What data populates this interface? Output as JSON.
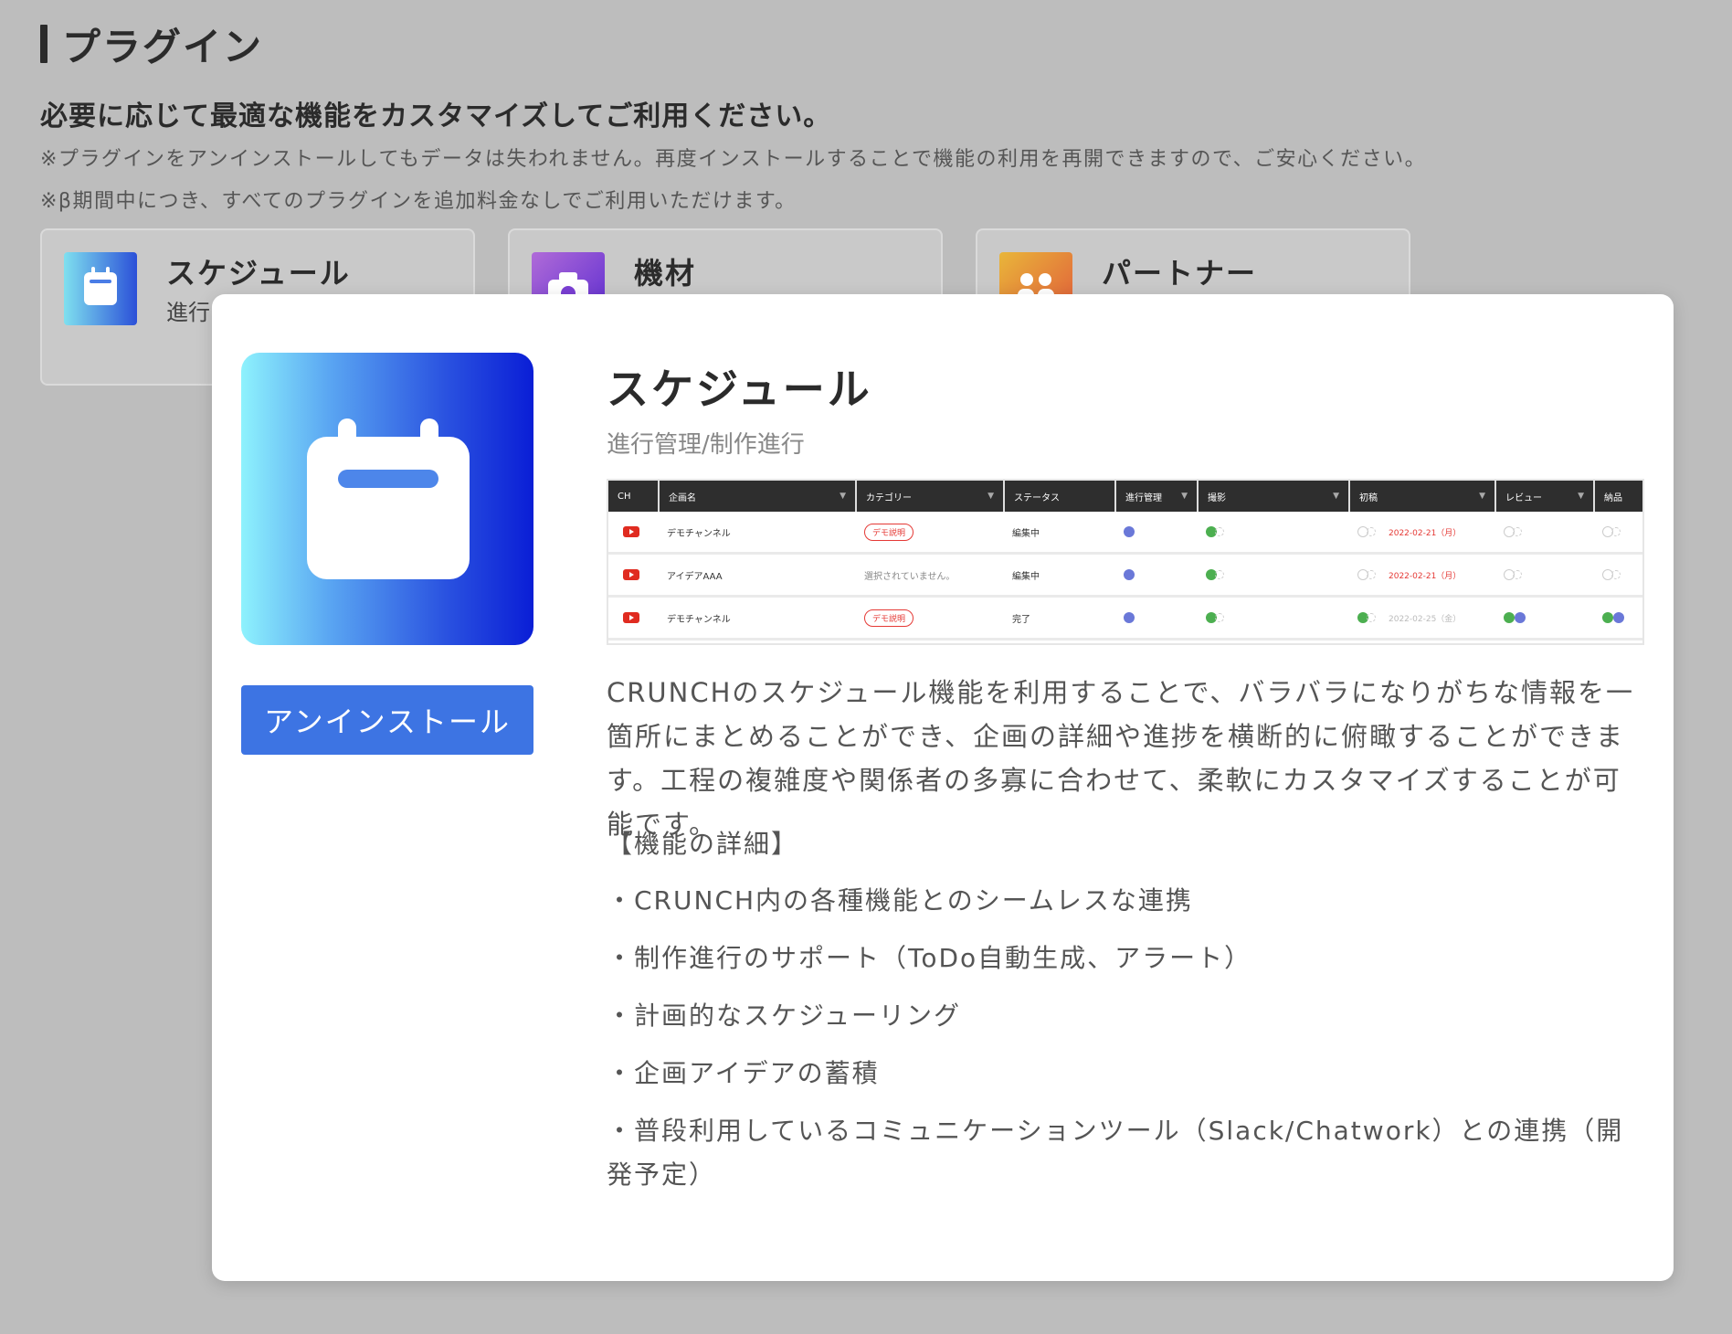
{
  "page": {
    "title": "プラグイン",
    "subtitle": "必要に応じて最適な機能をカスタマイズしてご利用ください。",
    "note1": "※プラグインをアンインストールしてもデータは失われません。再度インストールすることで機能の利用を再開できますので、ご安心ください。",
    "note2": "※β期間中につき、すべてのプラグインを追加料金なしでご利用いただけます。"
  },
  "plugins": [
    {
      "name": "スケジュール",
      "sub": "進行",
      "icon": "calendar-icon"
    },
    {
      "name": "機材",
      "sub": "",
      "icon": "camera-icon"
    },
    {
      "name": "パートナー",
      "sub": "",
      "icon": "people-icon"
    }
  ],
  "modal": {
    "title": "スケジュール",
    "subtitle": "進行管理/制作進行",
    "uninstall_label": "アンインストール",
    "icon": "calendar-icon",
    "description": "CRUNCHのスケジュール機能を利用することで、バラバラになりがちな情報を一箇所にまとめることができ、企画の詳細や進捗を横断的に俯瞰することができます。工程の複雑度や関係者の多寡に合わせて、柔軟にカスタマイズすることが可能です。",
    "features_heading": "【機能の詳細】",
    "features": [
      "・CRUNCH内の各種機能とのシームレスな連携",
      "・制作進行のサポート（ToDo自動生成、アラート）",
      "・計画的なスケジューリング",
      "・企画アイデアの蓄積",
      "・普段利用しているコミュニケーションツール（Slack/Chatwork）との連携（開発予定）"
    ]
  },
  "preview": {
    "headers": [
      "CH",
      "企画名",
      "カテゴリー",
      "ステータス",
      "進行管理",
      "撮影",
      "初稿",
      "レビュー",
      "納品"
    ],
    "rows": [
      {
        "name": "デモチャンネル",
        "category": "デモ説明",
        "status": "編集中",
        "date": "2022-02-21（月）"
      },
      {
        "name": "アイデアAAA",
        "category": "選択されていません。",
        "status": "編集中",
        "date": "2022-02-21（月）"
      },
      {
        "name": "デモチャンネル",
        "category": "デモ説明",
        "status": "完了",
        "date": "2022-02-25（金）"
      }
    ]
  },
  "colors": {
    "accent": "#3d74e3",
    "overlay_bg": "#bdbdbd",
    "youtube_red": "#e02b20"
  }
}
